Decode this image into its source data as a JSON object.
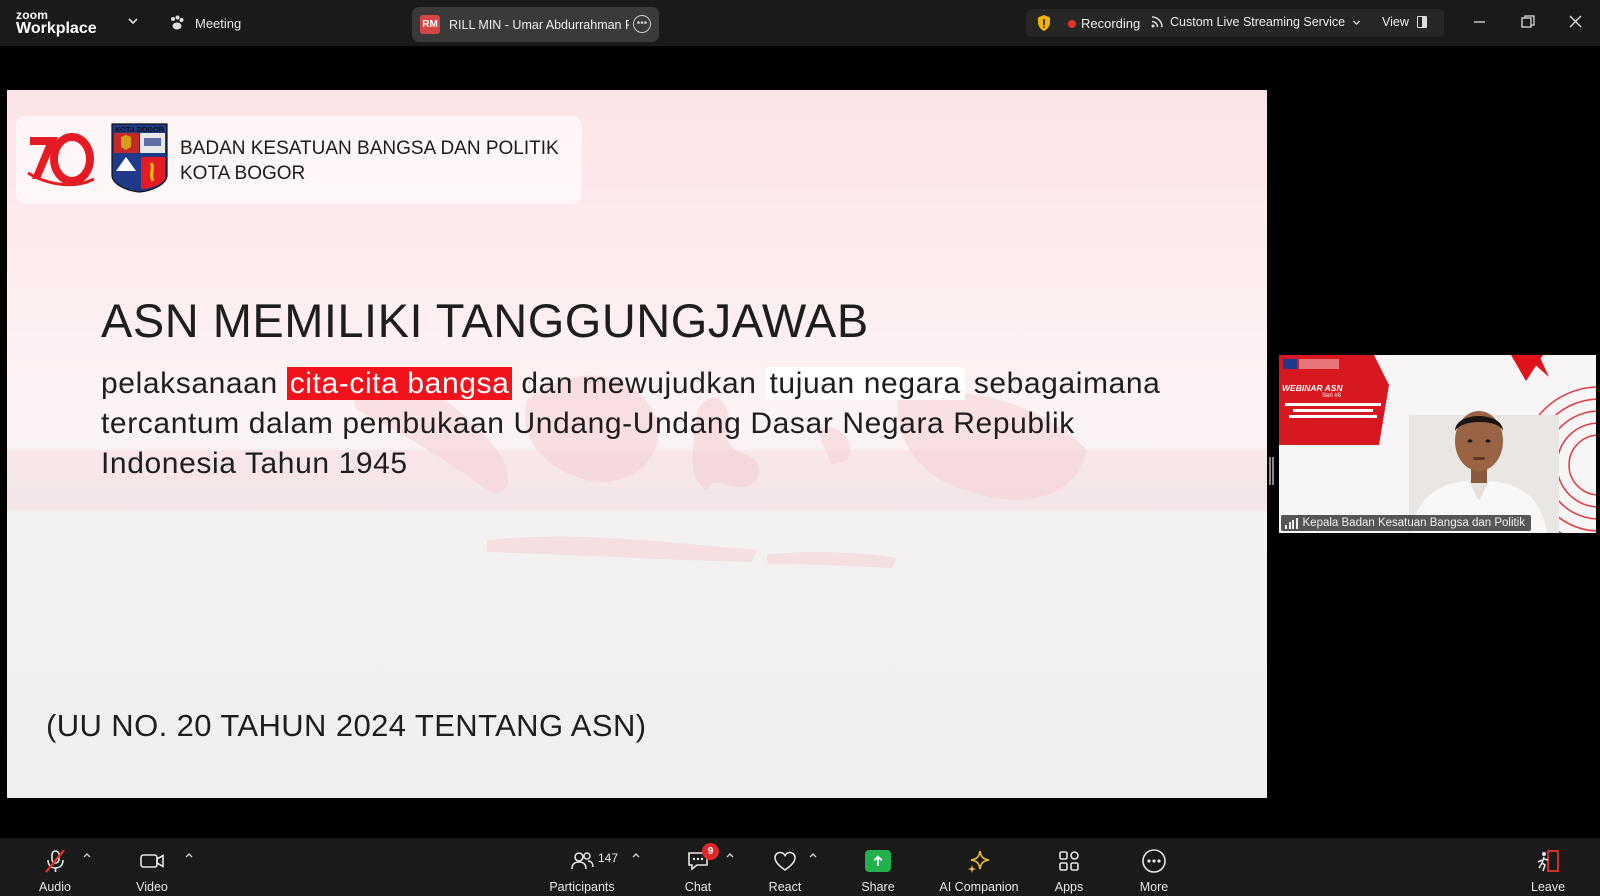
{
  "topbar": {
    "brand_small": "zoom",
    "brand_large": "Workplace",
    "meeting_label": "Meeting",
    "share_initials": "RM",
    "share_name": "RILL MIN - Umar Abdurrahman R",
    "recording_label": "Recording",
    "stream_label": "Custom Live Streaming Service",
    "view_label": "View"
  },
  "slide": {
    "org_line1": "BADAN KESATUAN BANGSA DAN POLITIK",
    "org_line2": "KOTA BOGOR",
    "crest_label": "KOTA BOGOR",
    "title": "ASN MEMILIKI TANGGUNGJAWAB",
    "body_pre": "pelaksanaan ",
    "body_hl_red": "cita-cita bangsa",
    "body_mid": " dan mewujudkan ",
    "body_hl_white": "tujuan negara",
    "body_post": " sebagaimana tercantum dalam pembukaan Undang-Undang Dasar Negara Republik Indonesia Tahun 1945",
    "reference": "(UU NO. 20 TAHUN 2024 TENTANG ASN)"
  },
  "participant_tile": {
    "webinar_text": "WEBINAR ASN",
    "seri_text": "Seri #8",
    "name": "Kepala Badan Kesatuan Bangsa dan Politik"
  },
  "toolbar": {
    "audio": "Audio",
    "video": "Video",
    "participants": "Participants",
    "participants_count": "147",
    "chat": "Chat",
    "chat_badge": "9",
    "react": "React",
    "share": "Share",
    "ai_companion": "AI Companion",
    "apps": "Apps",
    "more": "More",
    "leave": "Leave"
  },
  "colors": {
    "accent_red": "#f2121b",
    "share_green": "#22b14c",
    "badge_red": "#e02828"
  }
}
